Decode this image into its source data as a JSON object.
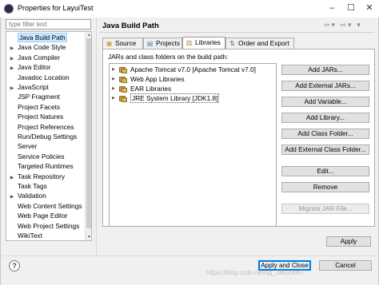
{
  "window": {
    "title": "Properties for LayuiTest",
    "controls": {
      "minimize": "–",
      "maximize": "☐",
      "close": "✕"
    }
  },
  "filter": {
    "placeholder": "type filter text"
  },
  "tree": {
    "items": [
      {
        "label": "Java Build Path",
        "expandable": false,
        "selected": true
      },
      {
        "label": "Java Code Style",
        "expandable": true
      },
      {
        "label": "Java Compiler",
        "expandable": true
      },
      {
        "label": "Java Editor",
        "expandable": true
      },
      {
        "label": "Javadoc Location",
        "expandable": false
      },
      {
        "label": "JavaScript",
        "expandable": true
      },
      {
        "label": "JSP Fragment",
        "expandable": false
      },
      {
        "label": "Project Facets",
        "expandable": false
      },
      {
        "label": "Project Natures",
        "expandable": false
      },
      {
        "label": "Project References",
        "expandable": false
      },
      {
        "label": "Run/Debug Settings",
        "expandable": false
      },
      {
        "label": "Server",
        "expandable": false
      },
      {
        "label": "Service Policies",
        "expandable": false
      },
      {
        "label": "Targeted Runtimes",
        "expandable": false
      },
      {
        "label": "Task Repository",
        "expandable": true
      },
      {
        "label": "Task Tags",
        "expandable": false
      },
      {
        "label": "Validation",
        "expandable": true
      },
      {
        "label": "Web Content Settings",
        "expandable": false
      },
      {
        "label": "Web Page Editor",
        "expandable": false
      },
      {
        "label": "Web Project Settings",
        "expandable": false
      },
      {
        "label": "WikiText",
        "expandable": false
      }
    ]
  },
  "page": {
    "title": "Java Build Path",
    "back_icon": "⇦",
    "forward_icon": "⇨",
    "menu_icon": "▾"
  },
  "tabs": [
    {
      "label": "Source",
      "icon": "source-folder-icon",
      "active": false
    },
    {
      "label": "Projects",
      "icon": "projects-icon",
      "active": false
    },
    {
      "label": "Libraries",
      "icon": "libraries-icon",
      "active": true
    },
    {
      "label": "Order and Export",
      "icon": "order-export-icon",
      "active": false
    }
  ],
  "libraries": {
    "heading": "JARs and class folders on the build path:",
    "entries": [
      {
        "label": "Apache Tomcat v7.0 [Apache Tomcat v7.0]",
        "selected": false
      },
      {
        "label": "Web App Libraries",
        "selected": false
      },
      {
        "label": "EAR Libraries",
        "selected": false
      },
      {
        "label": "JRE System Library [JDK1.8]",
        "selected": true
      }
    ],
    "buttons": {
      "add_jars": "Add JARs...",
      "add_external_jars": "Add External JARs...",
      "add_variable": "Add Variable...",
      "add_library": "Add Library...",
      "add_class_folder": "Add Class Folder...",
      "add_external_class_folder": "Add External Class Folder...",
      "edit": "Edit...",
      "remove": "Remove",
      "migrate_jar": "Migrate JAR File..."
    }
  },
  "footer": {
    "apply": "Apply",
    "apply_and_close": "Apply and Close",
    "cancel": "Cancel",
    "help": "?",
    "watermark": "https://blog.csdn.net/qq_38029067"
  },
  "colors": {
    "selection": "#cce8ff",
    "default_button_border": "#0078d7",
    "library_icon": "#c89a3e"
  }
}
